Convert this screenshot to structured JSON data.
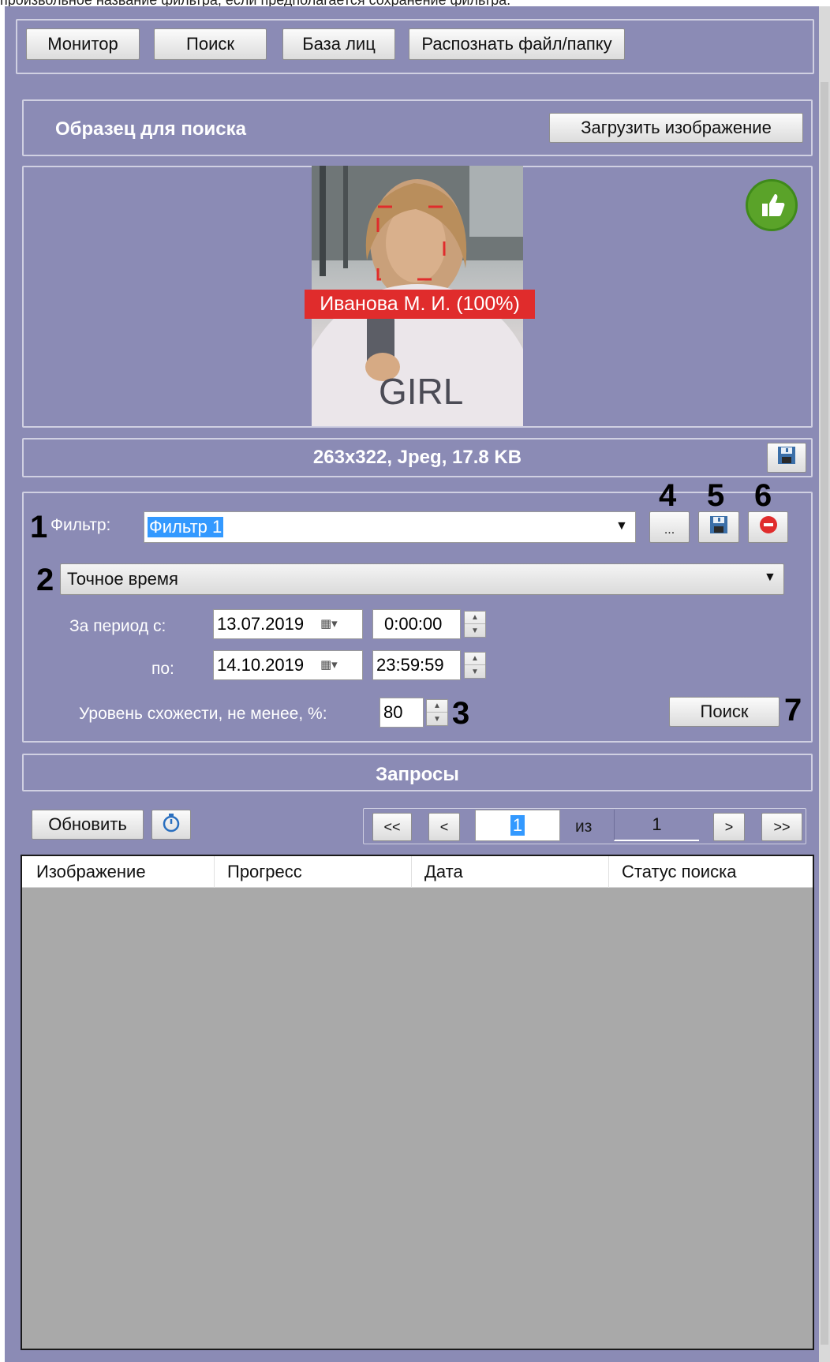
{
  "caption": "произвольное название фильтра, если предполагается сохранение фильтра.",
  "nav": {
    "monitor": "Монитор",
    "search": "Поиск",
    "face_db": "База лиц",
    "recognize": "Распознать файл/папку"
  },
  "sample": {
    "title": "Образец для поиска",
    "upload_label": "Загрузить изображение",
    "face_label": "Иванова М. И. (100%)",
    "shirt_text": "GIRL",
    "file_info": "263x322, Jpeg, 17.8 KB"
  },
  "filter": {
    "label": "Фильтр:",
    "value": "Фильтр 1",
    "more_label": "...",
    "mode": "Точное время",
    "period_from_label": "За период с:",
    "period_to_label": "по:",
    "date_from": "13.07.2019",
    "time_from": "0:00:00",
    "date_to": "14.10.2019",
    "time_to": "23:59:59",
    "similarity_label": "Уровень схожести, не менее, %:",
    "similarity": "80",
    "search_label": "Поиск"
  },
  "markers": [
    "1",
    "2",
    "3",
    "4",
    "5",
    "6",
    "7"
  ],
  "requests": {
    "title": "Запросы",
    "refresh_label": "Обновить",
    "first": "<<",
    "prev": "<",
    "page": "1",
    "of_label": "из",
    "total_pages": "1",
    "next": ">",
    "last": ">>",
    "columns": [
      "Изображение",
      "Прогресс",
      "Дата",
      "Статус поиска"
    ]
  },
  "colors": {
    "panel": "#8b8bb5",
    "accept": "#5aa329",
    "face_label_bg": "#e02c2c",
    "grid_body": "#a9a9a9"
  },
  "icons": {
    "accept": "thumbs-up-icon",
    "save": "floppy-disk-icon",
    "delete": "minus-circle-icon",
    "calendar": "calendar-icon",
    "timer": "stopwatch-icon"
  }
}
